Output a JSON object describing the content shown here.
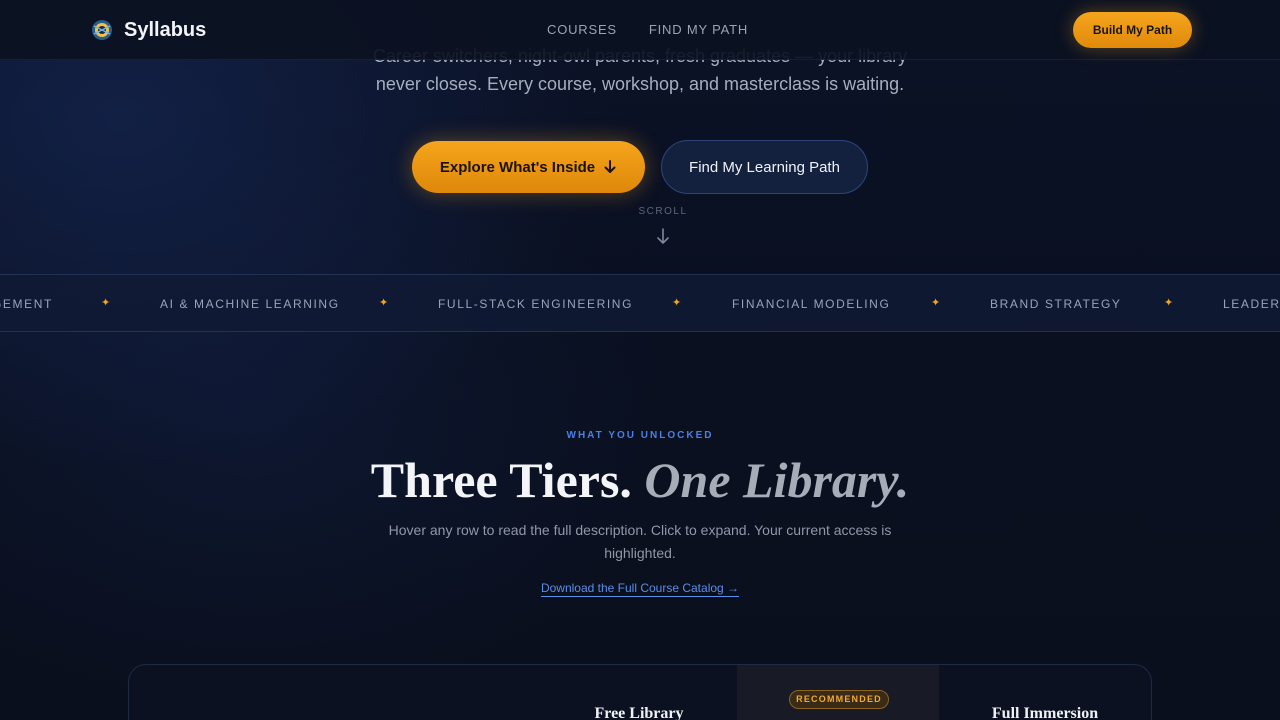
{
  "nav": {
    "brand": "Syllabus",
    "links": [
      "COURSES",
      "FIND MY PATH"
    ],
    "cta": "Build My Path"
  },
  "hero": {
    "subtitle_line1": "Career switchers, night-owl parents, fresh graduates — your library",
    "subtitle_line2": "never closes. Every course, workshop, and masterclass is waiting.",
    "primary_button": "Explore What's Inside",
    "secondary_button": "Find My Learning Path",
    "scroll_label": "SCROLL"
  },
  "ticker": {
    "items": [
      "GEMENT",
      "AI & MACHINE LEARNING",
      "FULL-STACK ENGINEERING",
      "FINANCIAL MODELING",
      "BRAND STRATEGY",
      "LEADERS"
    ],
    "separator": "✦"
  },
  "section": {
    "eyebrow": "WHAT YOU UNLOCKED",
    "headline_strong": "Three Tiers.",
    "headline_soft": "One Library.",
    "description": "Hover any row to read the full description. Click to expand. Your current access is highlighted.",
    "catalog_link": "Download the Full Course Catalog →"
  },
  "tiers": {
    "badge": "RECOMMENDED",
    "col1": "Free Library",
    "col3": "Full Immersion"
  },
  "colors": {
    "accent": "#f5a51c",
    "link": "#5a8ee8",
    "background": "#0a1020"
  }
}
